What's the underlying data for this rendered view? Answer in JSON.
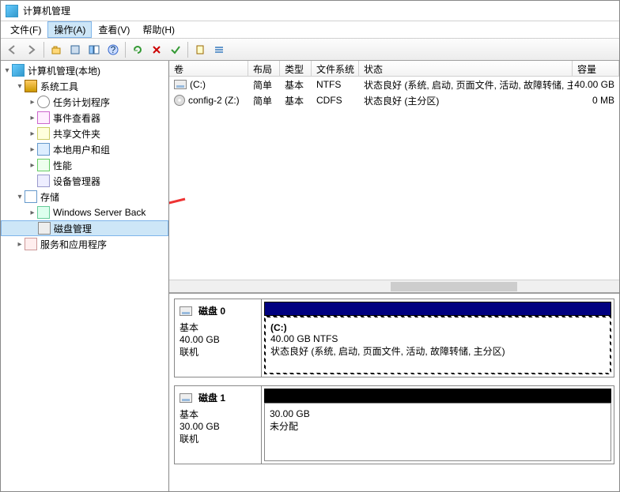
{
  "window": {
    "title": "计算机管理"
  },
  "menu": {
    "file": "文件(F)",
    "action": "操作(A)",
    "view": "查看(V)",
    "help": "帮助(H)",
    "active": "action"
  },
  "tree": {
    "root": "计算机管理(本地)",
    "system_tools": "系统工具",
    "task_scheduler": "任务计划程序",
    "event_viewer": "事件查看器",
    "shared_folders": "共享文件夹",
    "local_users": "本地用户和组",
    "performance": "性能",
    "device_manager": "设备管理器",
    "storage": "存储",
    "wsbackup": "Windows Server Back",
    "disk_mgmt": "磁盘管理",
    "services_apps": "服务和应用程序",
    "selected": "disk_mgmt"
  },
  "columns": {
    "volume": "卷",
    "layout": "布局",
    "type": "类型",
    "fs": "文件系统",
    "status": "状态",
    "capacity": "容量"
  },
  "volumes": [
    {
      "name": "(C:)",
      "icon": "disk",
      "layout": "简单",
      "type": "基本",
      "fs": "NTFS",
      "status": "状态良好 (系统, 启动, 页面文件, 活动, 故障转储, 主分区)",
      "capacity": "40.00 GB"
    },
    {
      "name": "config-2 (Z:)",
      "icon": "cd",
      "layout": "简单",
      "type": "基本",
      "fs": "CDFS",
      "status": "状态良好 (主分区)",
      "capacity": "0 MB"
    }
  ],
  "disks": [
    {
      "label": "磁盘 0",
      "kind": "基本",
      "size": "40.00 GB",
      "state": "联机",
      "header_style": "navy",
      "partitions": [
        {
          "name": "(C:)",
          "line2": "40.00 GB NTFS",
          "line3": "状态良好 (系统, 启动, 页面文件, 活动, 故障转储, 主分区)",
          "frame": "hatched"
        }
      ]
    },
    {
      "label": "磁盘 1",
      "kind": "基本",
      "size": "30.00 GB",
      "state": "联机",
      "header_style": "solidblack",
      "partitions": [
        {
          "name": "",
          "line2": "30.00 GB",
          "line3": "未分配",
          "frame": "plain"
        }
      ]
    }
  ]
}
